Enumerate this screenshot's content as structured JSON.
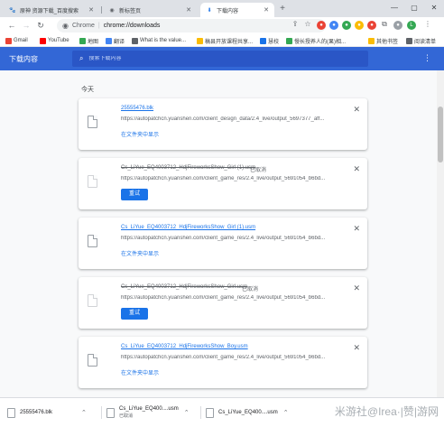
{
  "tabs": [
    {
      "title": "原神 资源下载_百度搜索",
      "active": false
    },
    {
      "title": "新标签页",
      "active": false
    },
    {
      "title": "下载内容",
      "active": true
    }
  ],
  "window_controls": {
    "minimize": "—",
    "maximize": "▢",
    "close": "✕"
  },
  "toolbar": {
    "back": "←",
    "forward": "→",
    "reload": "↻",
    "scheme_label": "Chrome",
    "divider": "|",
    "url": "chrome://downloads",
    "avatar_letter": "L"
  },
  "bookmarks": [
    {
      "label": "Gmail",
      "color": "#ea4335"
    },
    {
      "label": "YouTube",
      "color": "#ff0000"
    },
    {
      "label": "地图",
      "color": "#34a853"
    },
    {
      "label": "翻译",
      "color": "#4285f4"
    },
    {
      "label": "What is the value...",
      "color": "#5f6368"
    },
    {
      "label": "稿县开放课程共享...",
      "color": "#fbbc04"
    },
    {
      "label": "慧校",
      "color": "#1a73e8"
    },
    {
      "label": "慢长授养人的(果)相...",
      "color": "#34a853"
    },
    {
      "label": "其他书签",
      "color": "#fbbc04"
    },
    {
      "label": "阅读清单",
      "color": "#5f6368"
    }
  ],
  "downloads_page": {
    "title": "下载内容",
    "search_placeholder": "搜索下载内容",
    "date_group": "今天",
    "items": [
      {
        "filename": "25555476.blk",
        "status": "",
        "source": "https://autopatchcn.yuanshen.com/client_design_data/2.4_live/output_5697377_aff...",
        "action": "在文件夹中显示",
        "cancelled": false
      },
      {
        "filename": "Cs_LiYue_EQ4003712_HdjFireworksShow_Girl (1).usm",
        "status": "已取消",
        "source": "https://autopatchcn.yuanshen.com/client_game_res/2.4_live/output_5691054_b6bd...",
        "action": "重试",
        "cancelled": true
      },
      {
        "filename": "Cs_LiYue_EQ4003712_HdjFireworksShow_Girl (1).usm",
        "status": "",
        "source": "https://autopatchcn.yuanshen.com/client_game_res/2.4_live/output_5691054_b6bd...",
        "action": "在文件夹中显示",
        "cancelled": false
      },
      {
        "filename": "Cs_LiYue_EQ4003712_HdjFireworksShow_Girl.usm",
        "status": "已取消",
        "source": "https://autopatchcn.yuanshen.com/client_game_res/2.4_live/output_5691054_b6bd...",
        "action": "重试",
        "cancelled": true
      },
      {
        "filename": "Cs_LiYue_EQ4003712_HdjFireworksShow_Boy.usm",
        "status": "",
        "source": "https://autopatchcn.yuanshen.com/client_game_res/2.4_live/output_5691054_b6bd...",
        "action": "在文件夹中显示",
        "cancelled": false
      }
    ]
  },
  "shelf": {
    "items": [
      {
        "name": "25555476.blk",
        "sub": ""
      },
      {
        "name": "Cs_LiYue_EQ400....usm",
        "sub": "已取消"
      },
      {
        "name": "Cs_LiYue_EQ400....usm",
        "sub": ""
      }
    ],
    "watermark": "米游社@Irea·|赞|游网"
  }
}
